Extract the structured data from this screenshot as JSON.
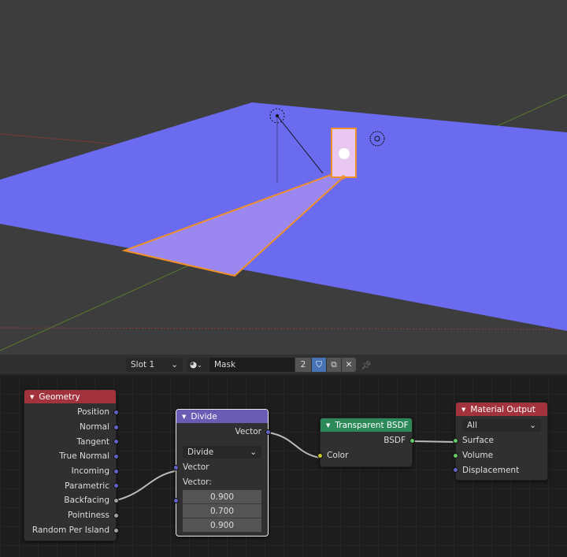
{
  "header": {
    "slot": "Slot 1",
    "material_name": "Mask",
    "user_count": "2"
  },
  "nodes": {
    "geometry": {
      "title": "Geometry",
      "color": "#a2323b",
      "outputs": [
        "Position",
        "Normal",
        "Tangent",
        "True Normal",
        "Incoming",
        "Parametric",
        "Backfacing",
        "Pointiness",
        "Random Per Island"
      ]
    },
    "divide": {
      "title": "Divide",
      "color": "#6a5bb5",
      "output": "Vector",
      "operation": "Divide",
      "input1": "Vector",
      "input2": "Vector:",
      "values": [
        "0.900",
        "0.700",
        "0.900"
      ]
    },
    "transparent": {
      "title": "Transparent BSDF",
      "color": "#2c8a5a",
      "output": "BSDF",
      "input": "Color"
    },
    "output": {
      "title": "Material Output",
      "color": "#a2323b",
      "target": "All",
      "inputs": [
        "Surface",
        "Volume",
        "Displacement"
      ]
    }
  },
  "colors": {
    "vector_socket": "#6363c7",
    "shader_socket": "#63c763",
    "color_socket": "#c7c729",
    "float_socket": "#a1a1a1",
    "plane": "#6b6bf0",
    "selection": "#f0902a"
  }
}
